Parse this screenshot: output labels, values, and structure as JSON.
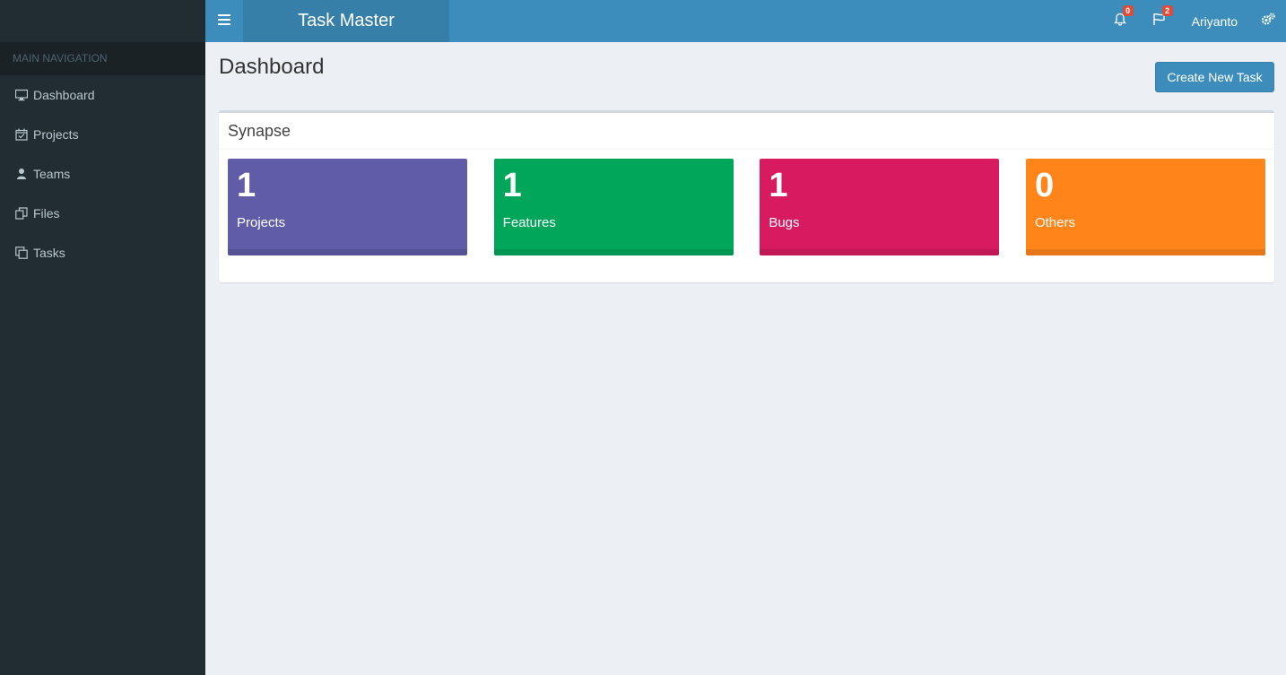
{
  "header": {
    "brand": "Task Master",
    "notifications_count": "0",
    "flags_count": "2",
    "user_name": "Ariyanto"
  },
  "sidebar": {
    "header": "MAIN NAVIGATION",
    "items": [
      {
        "label": "Dashboard",
        "icon": "monitor-icon"
      },
      {
        "label": "Projects",
        "icon": "calendar-check-icon"
      },
      {
        "label": "Teams",
        "icon": "user-icon"
      },
      {
        "label": "Files",
        "icon": "files-icon"
      },
      {
        "label": "Tasks",
        "icon": "copy-icon"
      }
    ]
  },
  "main": {
    "title": "Dashboard",
    "create_button": "Create New Task",
    "box_title": "Synapse",
    "tiles": [
      {
        "value": "1",
        "label": "Projects",
        "color": "#605ca8"
      },
      {
        "value": "1",
        "label": "Features",
        "color": "#00a65a"
      },
      {
        "value": "1",
        "label": "Bugs",
        "color": "#d81b60"
      },
      {
        "value": "0",
        "label": "Others",
        "color": "#ff851b"
      }
    ]
  }
}
